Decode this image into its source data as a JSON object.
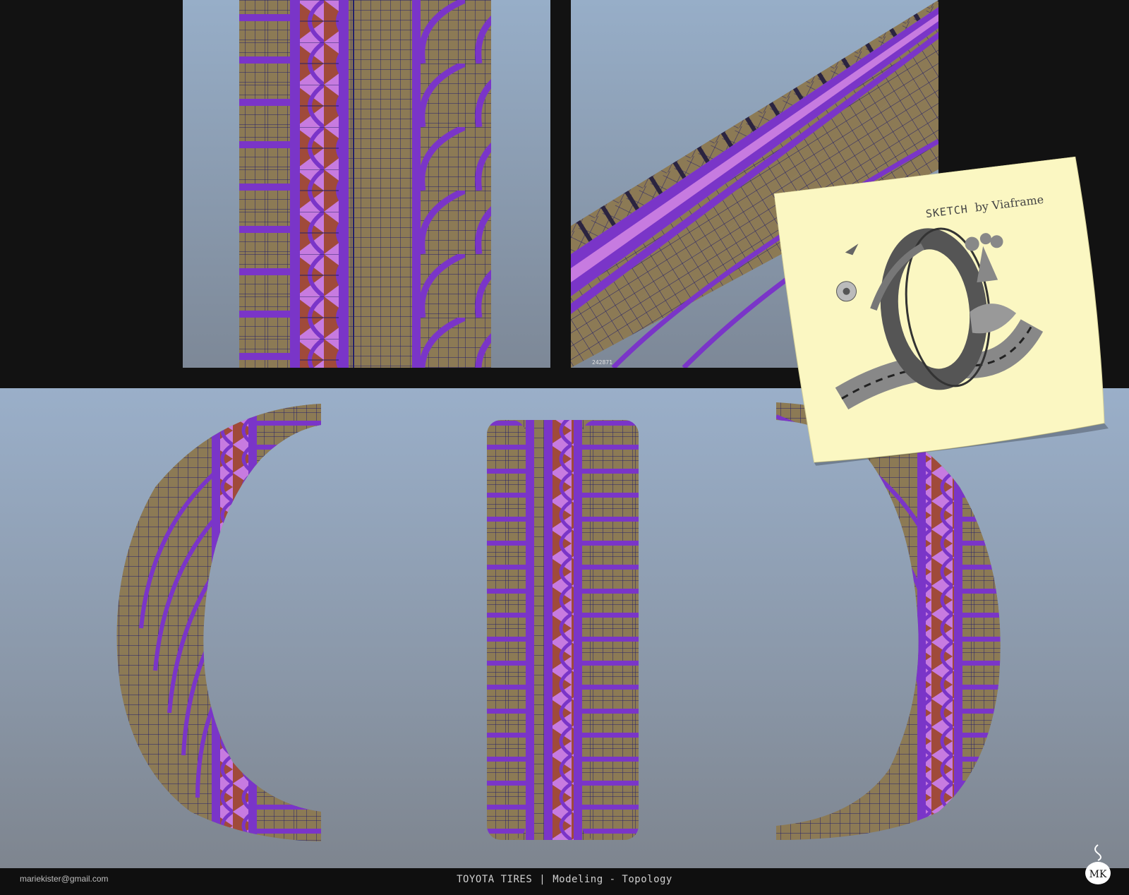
{
  "sticky_note": {
    "title_word": "SKETCH",
    "title_by": "by Viaframe"
  },
  "viewport_label": "242871",
  "footer": {
    "email": "mariekister@gmail.com",
    "project": "TOYOTA TIRES",
    "separator": "|",
    "subtitle": "Modeling - Topology"
  },
  "logo_text": "MK",
  "colors": {
    "tread_rubber": "#8c7a55",
    "groove_purple": "#7a35c8",
    "groove_pink": "#c77be0",
    "groove_red": "#a04a3a",
    "wire_blue": "#2a2a80",
    "viewport_top": "#97aec8",
    "viewport_bottom": "#7d8897",
    "note_yellow": "#fbf7c2"
  },
  "icons": [
    "sticky-note-sketch-image",
    "mk-logo-icon"
  ]
}
